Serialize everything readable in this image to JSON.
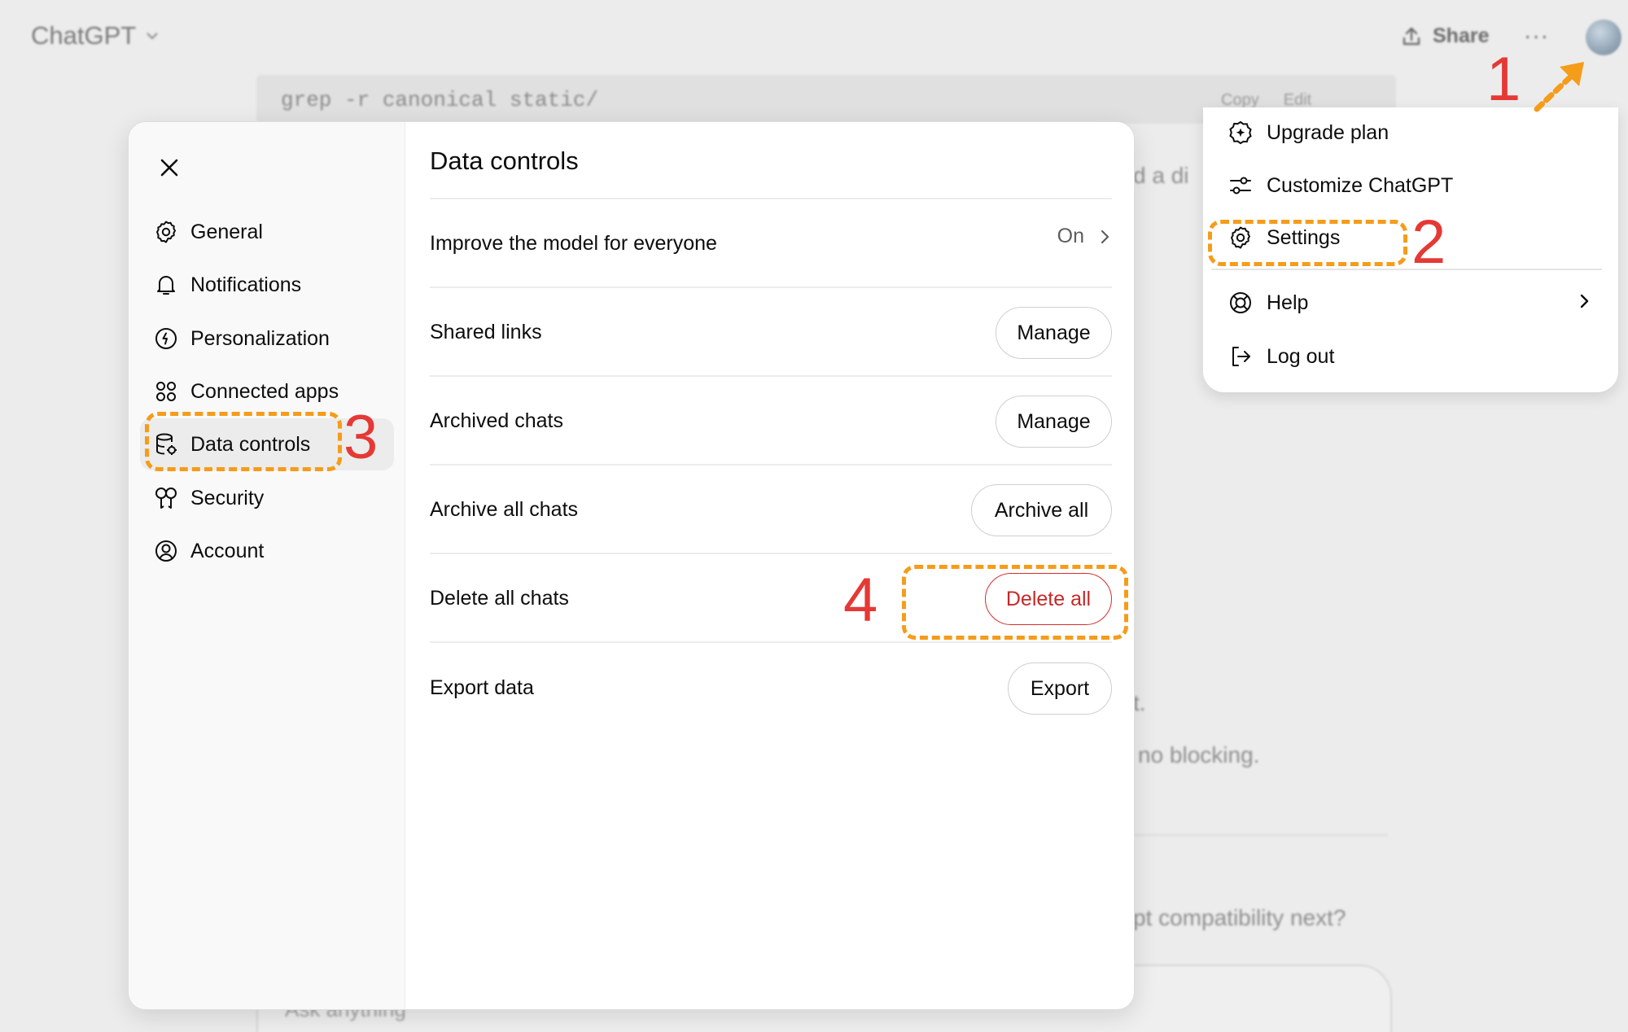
{
  "background": {
    "app_title": "ChatGPT",
    "share_label": "Share",
    "more_label": "···",
    "code_line": "grep -r canonical static/",
    "copy_label": "Copy",
    "edit_label": "Edit",
    "fragment_1": "d a di",
    "fragment_2": "t.",
    "fragment_3": "no blocking.",
    "fragment_4": "pt compatibility next?",
    "input_placeholder": "Ask anything"
  },
  "menu": {
    "items": [
      {
        "label": "Upgrade plan",
        "icon": "upgrade-icon"
      },
      {
        "label": "Customize ChatGPT",
        "icon": "sliders-icon"
      },
      {
        "label": "Settings",
        "icon": "gear-icon"
      },
      {
        "label": "Help",
        "icon": "lifebuoy-icon"
      },
      {
        "label": "Log out",
        "icon": "logout-icon"
      }
    ]
  },
  "settings": {
    "nav": [
      {
        "label": "General",
        "icon": "gear-icon"
      },
      {
        "label": "Notifications",
        "icon": "bell-icon"
      },
      {
        "label": "Personalization",
        "icon": "personalization-icon"
      },
      {
        "label": "Connected apps",
        "icon": "apps-icon"
      },
      {
        "label": "Data controls",
        "icon": "database-icon",
        "active": true
      },
      {
        "label": "Security",
        "icon": "key-icon"
      },
      {
        "label": "Account",
        "icon": "user-circle-icon"
      }
    ],
    "title": "Data controls",
    "rows": [
      {
        "label": "Improve the model for everyone",
        "value": "On"
      },
      {
        "label": "Shared links",
        "button": "Manage"
      },
      {
        "label": "Archived chats",
        "button": "Manage"
      },
      {
        "label": "Archive all chats",
        "button": "Archive all"
      },
      {
        "label": "Delete all chats",
        "button": "Delete all"
      },
      {
        "label": "Export data",
        "button": "Export"
      }
    ]
  },
  "annotations": {
    "step1": "1",
    "step2": "2",
    "step3": "3",
    "step4": "4",
    "highlight_color": "#f59c1a",
    "number_color": "#e53935"
  },
  "colors": {
    "danger": "#c62828",
    "active_nav_bg": "#ececec"
  }
}
